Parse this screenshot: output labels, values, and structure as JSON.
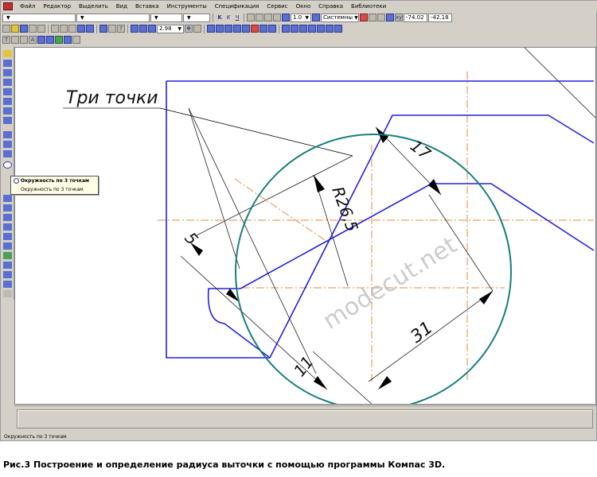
{
  "menu": [
    "Файл",
    "Редактор",
    "Выделить",
    "Вид",
    "Вставка",
    "Инструменты",
    "Спецификация",
    "Сервис",
    "Окно",
    "Справка",
    "Библиотеки"
  ],
  "toolbar": {
    "line_scale": "1.0",
    "coordinate_system": "Системны",
    "coord_x": "-74.02",
    "coord_y": "-42.18",
    "zoom": "2.98"
  },
  "tooltip": {
    "title": "Окружность по 3 точкам",
    "subtitle": "Окружность по 3 точкам"
  },
  "drawing": {
    "leader_text": "Три точки",
    "dim_radius": "R26,5",
    "dim_17": "17",
    "dim_5": "5",
    "dim_31": "31",
    "dim_11": "11",
    "watermark": "modecut.net"
  },
  "status_text": "Окружность по 3 точкам",
  "caption": "Рис.3 Построение и определение радиуса выточки с помощью программы Компас 3D.",
  "colors": {
    "contour": "#2222dd",
    "circle": "#1a7f7f",
    "centerline": "#e88a3a",
    "thin": "#222222"
  }
}
